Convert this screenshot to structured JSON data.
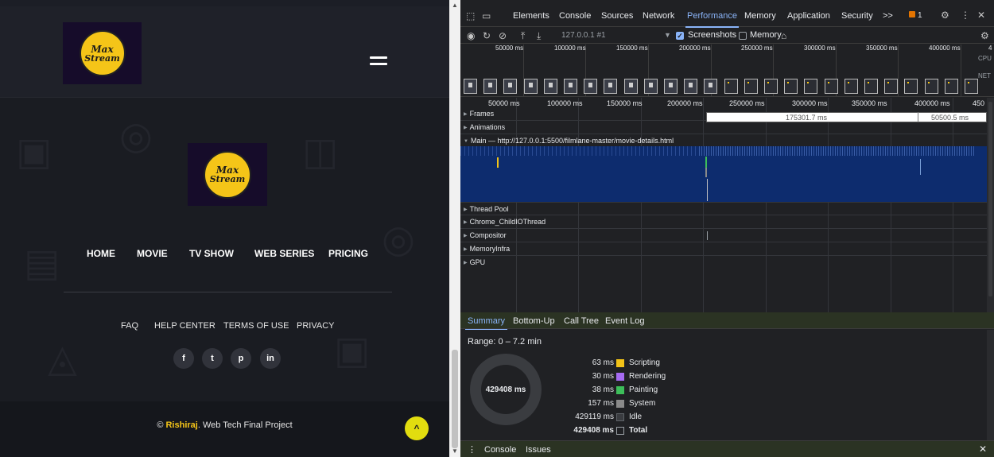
{
  "site": {
    "logo": {
      "line1": "Max",
      "line2": "Stream"
    },
    "nav": [
      "HOME",
      "MOVIE",
      "TV SHOW",
      "WEB SERIES",
      "PRICING"
    ],
    "links": [
      "FAQ",
      "HELP CENTER",
      "TERMS OF USE",
      "PRIVACY"
    ],
    "social": [
      {
        "icon": "facebook-icon",
        "glyph": "f"
      },
      {
        "icon": "twitter-icon",
        "glyph": "t"
      },
      {
        "icon": "pinterest-icon",
        "glyph": "p"
      },
      {
        "icon": "linkedin-icon",
        "glyph": "in"
      }
    ],
    "copyright": {
      "prefix": "© ",
      "brand": "Rishiraj",
      "suffix": ". Web Tech Final Project"
    },
    "scroll_top_glyph": "^",
    "colors": {
      "accent": "#f5c518",
      "scroll_button": "#e2dd0f",
      "background": "#1a1c22"
    }
  },
  "devtools": {
    "tabs": [
      "Elements",
      "Console",
      "Sources",
      "Network",
      "Performance",
      "Memory",
      "Application",
      "Security"
    ],
    "active_tab": "Performance",
    "more_tabs": ">>",
    "issues_count": "1",
    "toolbar": {
      "target": "127.0.0.1 #1",
      "screenshots_label": "Screenshots",
      "memory_label": "Memory",
      "screenshots_checked": true,
      "memory_checked": false
    },
    "overview": {
      "ticks": [
        "50000 ms",
        "100000 ms",
        "150000 ms",
        "200000 ms",
        "250000 ms",
        "300000 ms",
        "350000 ms",
        "400000 ms",
        "4"
      ],
      "cpu_label": "CPU",
      "net_label": "NET"
    },
    "timeline": {
      "ticks": [
        "50000 ms",
        "100000 ms",
        "150000 ms",
        "200000 ms",
        "250000 ms",
        "300000 ms",
        "350000 ms",
        "400000 ms",
        "450"
      ],
      "tracks": {
        "frames": "Frames",
        "animations": "Animations",
        "main": "Main — http://127.0.0.1:5500/filmlane-master/movie-details.html",
        "thread_pool": "Thread Pool",
        "child_io": "Chrome_ChildIOThread",
        "compositor": "Compositor",
        "memory_infra": "MemoryInfra",
        "gpu": "GPU"
      },
      "frame_durations": [
        "175301.7 ms",
        "50500.5 ms"
      ]
    },
    "summary_tabs": [
      "Summary",
      "Bottom-Up",
      "Call Tree",
      "Event Log"
    ],
    "summary": {
      "range": "Range: 0 – 7.2 min",
      "total_label": "429408 ms",
      "rows": [
        {
          "value": "63 ms",
          "name": "Scripting",
          "color": "#f2c318"
        },
        {
          "value": "30 ms",
          "name": "Rendering",
          "color": "#a66bf2"
        },
        {
          "value": "38 ms",
          "name": "Painting",
          "color": "#3dbe5a"
        },
        {
          "value": "157 ms",
          "name": "System",
          "color": "#8a8a8a"
        },
        {
          "value": "429119 ms",
          "name": "Idle",
          "color": "#3a3c40"
        },
        {
          "value": "429408 ms",
          "name": "Total",
          "color": "#202124"
        }
      ]
    },
    "drawer_tabs": [
      "Console",
      "Issues"
    ]
  }
}
